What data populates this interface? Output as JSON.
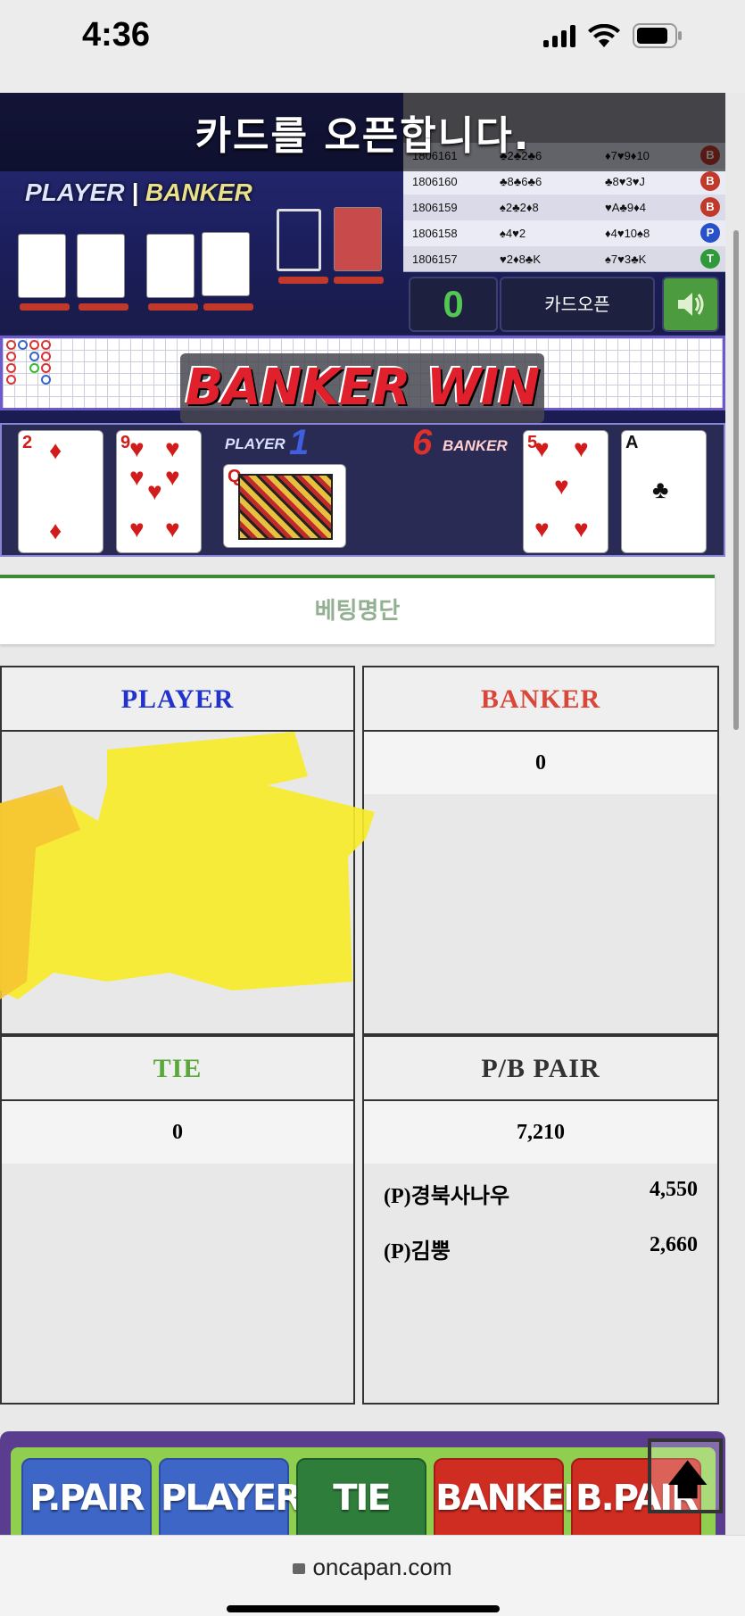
{
  "status": {
    "time": "4:36"
  },
  "game": {
    "notice": "카드를 오픈합니다.",
    "player_label": "PLAYER",
    "banker_label": "BANKER",
    "history": [
      {
        "id": "1806161",
        "player": "♣2♣2♣6",
        "banker": "♦7♥9♦10",
        "result": "B",
        "color": "#c0392b"
      },
      {
        "id": "1806160",
        "player": "♣8♣6♣6",
        "banker": "♣8♥3♥J",
        "result": "B",
        "color": "#c0392b"
      },
      {
        "id": "1806159",
        "player": "♠2♣2♦8",
        "banker": "♥A♣9♦4",
        "result": "B",
        "color": "#c0392b"
      },
      {
        "id": "1806158",
        "player": "♠4♥2",
        "banker": "♦4♥10♠8",
        "result": "P",
        "color": "#2850c8"
      },
      {
        "id": "1806157",
        "player": "♥2♦8♣K",
        "banker": "♠7♥3♣K",
        "result": "T",
        "color": "#2f9a3a"
      }
    ],
    "counter": "0",
    "open_button": "카드오픈",
    "banner": "BANKER WIN",
    "result": {
      "player_label": "PLAYER",
      "player_score": "1",
      "banker_label": "BANKER",
      "banker_score": "6",
      "player_cards": [
        {
          "rank": "2",
          "suit": "♦"
        },
        {
          "rank": "9",
          "suit": "♥"
        },
        {
          "rank": "Q",
          "suit": ""
        }
      ],
      "banker_cards": [
        {
          "rank": "5",
          "suit": "♥"
        },
        {
          "rank": "A",
          "suit": "♣"
        }
      ]
    }
  },
  "betting": {
    "title": "베팅명단",
    "player": {
      "label": "PLAYER",
      "color": "#2233cc"
    },
    "banker": {
      "label": "BANKER",
      "color": "#d9473a",
      "total": "0"
    },
    "tie": {
      "label": "TIE",
      "color": "#5aa83a",
      "total": "0"
    },
    "pair": {
      "label": "P/B PAIR",
      "color": "#333333",
      "total": "7,210",
      "rows": [
        {
          "name": "(P)경북사나우",
          "amount": "4,550"
        },
        {
          "name": "(P)김뿡",
          "amount": "2,660"
        }
      ]
    }
  },
  "buttons": {
    "p_pair": "P.PAIR",
    "player": "PLAYER",
    "tie": "TIE",
    "banker": "BANKER",
    "b_pair": "B.PAIR"
  },
  "browser": {
    "url": "oncapan.com"
  }
}
